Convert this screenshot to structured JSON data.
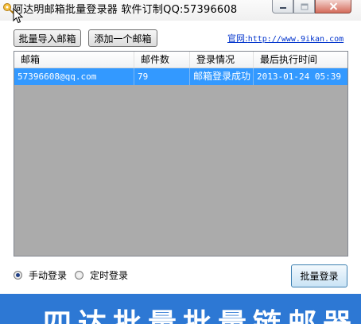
{
  "window": {
    "title": "阿达明邮箱批量登录器 软件订制QQ:57396608",
    "minimize_icon": "minimize-icon",
    "maximize_icon": "maximize-icon",
    "close_icon": "close-icon"
  },
  "toolbar": {
    "import_label": "批量导入邮箱",
    "add_label": "添加一个邮箱",
    "site_label": "官网:",
    "site_url": "http://www.9ikan.com"
  },
  "table": {
    "columns": [
      "邮箱",
      "邮件数",
      "登录情况",
      "最后执行时间"
    ],
    "rows": [
      [
        "57396608@qq.com",
        "79",
        "邮箱登录成功",
        "2013-01-24 05:39"
      ]
    ]
  },
  "controls": {
    "radio_manual": "手动登录",
    "radio_timer": "定时登录",
    "selected_mode": "手动登录",
    "login_button": "批量登录"
  },
  "banner": {
    "text": "四达批量批量链邮器"
  },
  "colors": {
    "selection": "#3399ff",
    "list_background": "#ababab",
    "banner": "#2d78d4",
    "link": "#0033cc"
  }
}
